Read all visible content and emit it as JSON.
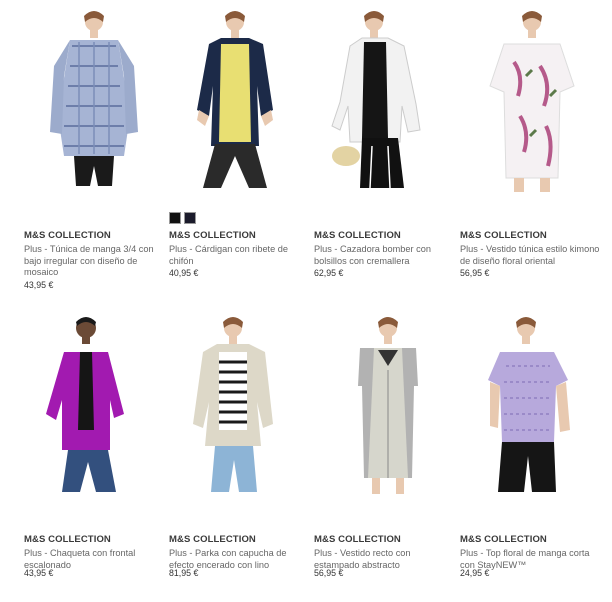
{
  "products": [
    {
      "brand": "M&S COLLECTION",
      "name": "Plus - Túnica de manga 3/4 con bajo irregular con diseño de mosaico",
      "price": "43,95 €",
      "swatches": []
    },
    {
      "brand": "M&S COLLECTION",
      "name": "Plus - Cárdigan con ribete de chifón",
      "price": "40,95 €",
      "swatches": [
        "#111111",
        "#1b1b2b"
      ]
    },
    {
      "brand": "M&S COLLECTION",
      "name": "Plus - Cazadora bomber con bolsillos con cremallera",
      "price": "62,95 €",
      "swatches": []
    },
    {
      "brand": "M&S COLLECTION",
      "name": "Plus - Vestido túnica estilo kimono de diseño floral oriental",
      "price": "56,95 €",
      "swatches": []
    },
    {
      "brand": "M&S COLLECTION",
      "name": "Plus - Chaqueta con frontal escalonado",
      "price": "43,95 €",
      "swatches": []
    },
    {
      "brand": "M&S COLLECTION",
      "name": "Plus - Parka con capucha de efecto encerado con lino",
      "price": "81,95 €",
      "swatches": []
    },
    {
      "brand": "M&S COLLECTION",
      "name": "Plus - Vestido recto con estampado abstracto",
      "price": "56,95 €",
      "swatches": []
    },
    {
      "brand": "M&S COLLECTION",
      "name": "Plus - Top floral de manga corta con StayNEW™",
      "price": "24,95 €",
      "swatches": []
    }
  ]
}
